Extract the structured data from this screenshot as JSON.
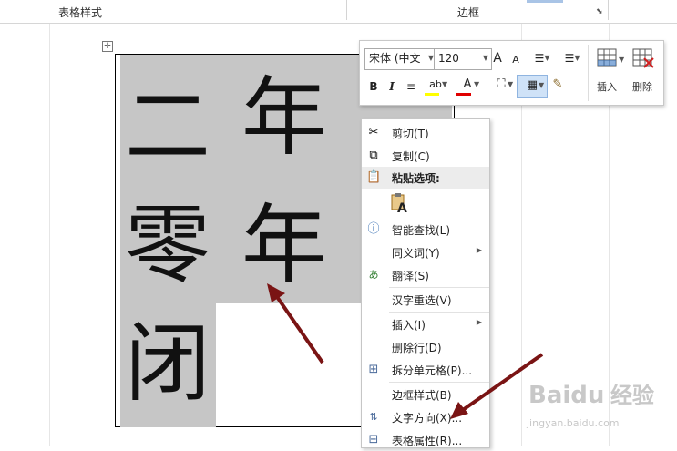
{
  "ribbon": {
    "group1": "表格样式",
    "group2": "边框",
    "launcher": "⬊"
  },
  "table": {
    "handle_glyph": "✛",
    "cells": [
      [
        "二",
        "年"
      ],
      [
        "零",
        "年"
      ],
      [
        "闭"
      ]
    ]
  },
  "toolbar": {
    "font_name": "宋体 (中文",
    "font_size": "120",
    "grow": "A",
    "shrink": "A",
    "bold": "B",
    "italic": "I",
    "highlight": "ab",
    "font_color": "A",
    "insert_label": "插入",
    "delete_label": "删除"
  },
  "menu": {
    "cut": "剪切(T)",
    "copy": "复制(C)",
    "paste_options": "粘贴选项:",
    "paste_glyph": "A",
    "smart_lookup": "智能查找(L)",
    "synonyms": "同义词(Y)",
    "translate": "翻译(S)",
    "reconvert": "汉字重选(V)",
    "insert": "插入(I)",
    "delete_row": "删除行(D)",
    "split_cells": "拆分单元格(P)...",
    "border_styles": "边框样式(B)",
    "text_direction": "文字方向(X)...",
    "table_properties": "表格属性(R)..."
  },
  "watermark": {
    "brand": "Baidu",
    "cn": "经验",
    "url": "jingyan.baidu.com"
  },
  "colors": {
    "selection": "#c6c6c6",
    "arrow": "#7a1414",
    "highlight_bar": "#ffff00",
    "font_color_bar": "#e00000"
  }
}
